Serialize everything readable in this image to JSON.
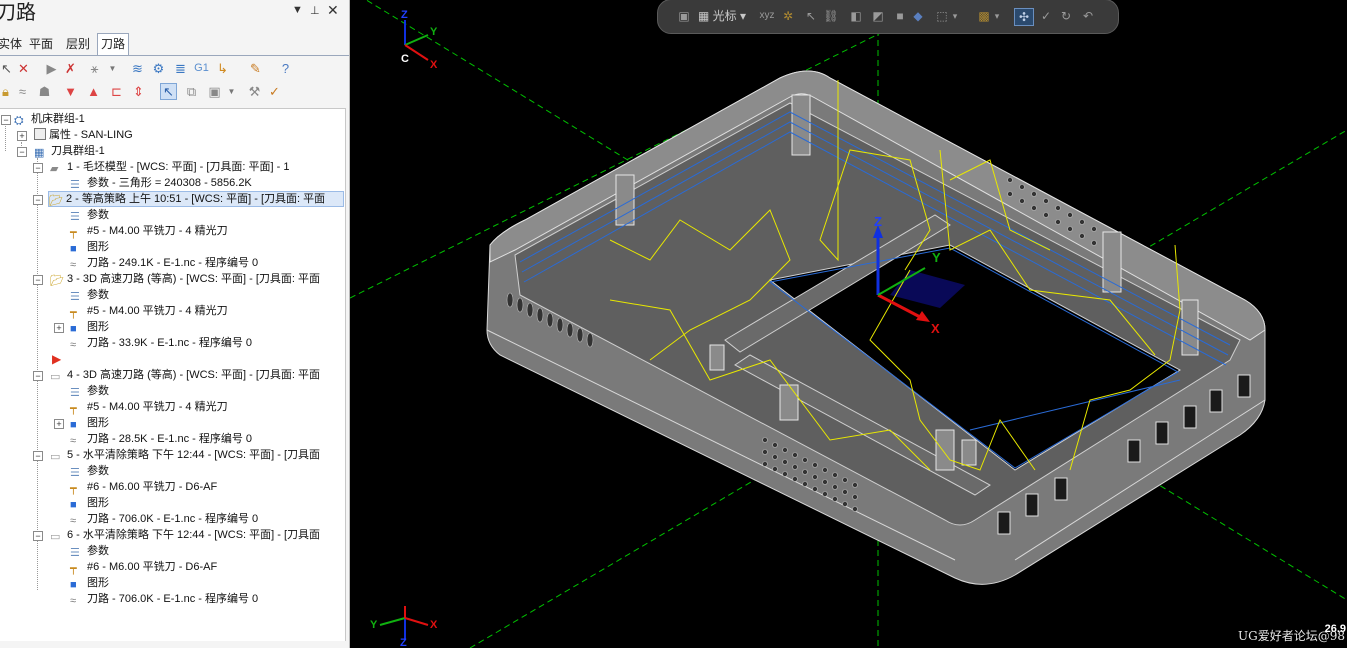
{
  "panel": {
    "title": "刀路",
    "tabs": [
      {
        "label": "实体"
      },
      {
        "label": "平面"
      },
      {
        "label": "层别"
      },
      {
        "label": "刀路"
      }
    ]
  },
  "toolbar": {
    "g1_label": "G1"
  },
  "tree": {
    "root": "机床群组-1",
    "properties": "属性 - SAN-LING",
    "tool_group": "刀具群组-1",
    "ops": [
      {
        "title": "1 - 毛坯模型 - [WCS: 平面] - [刀具面: 平面] - 1",
        "params": "参数 - 三角形 = 240308 - 5856.2K"
      },
      {
        "title": "2 - 等高策略 上午 10:51 - [WCS: 平面] - [刀具面: 平面",
        "params": "参数",
        "tool": "#5 - M4.00 平铣刀 - 4 精光刀",
        "geometry": "图形",
        "path": "刀路 - 249.1K - E-1.nc - 程序编号 0"
      },
      {
        "title": "3 - 3D 高速刀路 (等高) - [WCS: 平面] - [刀具面: 平面",
        "params": "参数",
        "tool": "#5 - M4.00 平铣刀 - 4 精光刀",
        "geometry": "图形",
        "path": "刀路 - 33.9K - E-1.nc - 程序编号 0"
      },
      {
        "title": "4 - 3D 高速刀路 (等高) - [WCS: 平面] - [刀具面: 平面",
        "params": "参数",
        "tool": "#5 - M4.00 平铣刀 - 4 精光刀",
        "geometry": "图形",
        "path": "刀路 - 28.5K - E-1.nc - 程序编号 0"
      },
      {
        "title": "5 - 水平清除策略 下午 12:44 - [WCS: 平面] - [刀具面",
        "params": "参数",
        "tool": "#6 - M6.00 平铣刀 - D6-AF",
        "geometry": "图形",
        "path": "刀路 - 706.0K - E-1.nc - 程序编号 0"
      },
      {
        "title": "6 - 水平清除策略 下午 12:44 - [WCS: 平面] - [刀具面",
        "params": "参数",
        "tool": "#6 - M6.00 平铣刀 - D6-AF",
        "geometry": "图形",
        "path": "刀路 - 706.0K - E-1.nc - 程序编号 0"
      }
    ]
  },
  "viewport": {
    "toolbar": {
      "cursor_label": "光标",
      "xyz_label": "xyz"
    },
    "axis_top": {
      "z": "Z",
      "y": "Y",
      "x": "X",
      "c": "C"
    },
    "axis_center": {
      "z": "Z",
      "y": "Y",
      "x": "X"
    },
    "axis_bottom": {
      "z": "Z",
      "y": "Y",
      "x": "X"
    },
    "watermark": "UG爱好者论坛@98",
    "coord_readout": "26.9"
  },
  "colors": {
    "background": "#000000",
    "model": "#8c8c8c",
    "toolpath": "#e8e800",
    "contour": "#2a6bd6",
    "grid_axis": "#00c000",
    "axis_x": "#e01010",
    "axis_y": "#10b010",
    "axis_z": "#1030e0"
  }
}
